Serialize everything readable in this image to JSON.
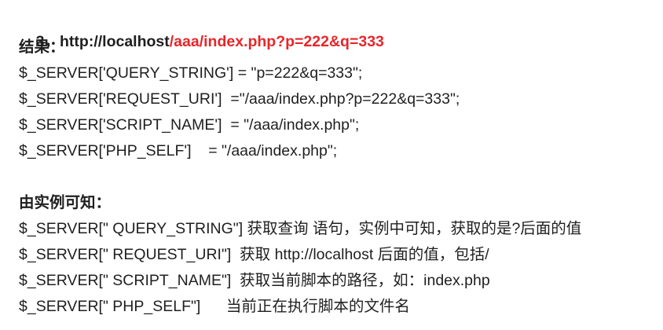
{
  "heading": {
    "prefix": "3，http://localhost",
    "url_rest": "/aaa/index.php?p=222&q=333"
  },
  "result_label": "结果：",
  "results": [
    "$_SERVER['QUERY_STRING'] = \"p=222&q=333\";",
    "$_SERVER['REQUEST_URI']  =\"/aaa/index.php?p=222&q=333\";",
    "$_SERVER['SCRIPT_NAME']  = \"/aaa/index.php\";",
    "$_SERVER['PHP_SELF']    = \"/aaa/index.php\";"
  ],
  "conclusion_label": "由实例可知：",
  "conclusions": [
    "$_SERVER[\" QUERY_STRING\"] 获取查询 语句，实例中可知，获取的是?后面的值",
    "$_SERVER[\" REQUEST_URI\"]  获取 http://localhost 后面的值，包括/",
    "$_SERVER[\" SCRIPT_NAME\"]  获取当前脚本的路径，如：index.php",
    "$_SERVER[\" PHP_SELF\"]      当前正在执行脚本的文件名"
  ],
  "colors": {
    "text": "#1f1f1f",
    "url_highlight": "#e8262a"
  }
}
